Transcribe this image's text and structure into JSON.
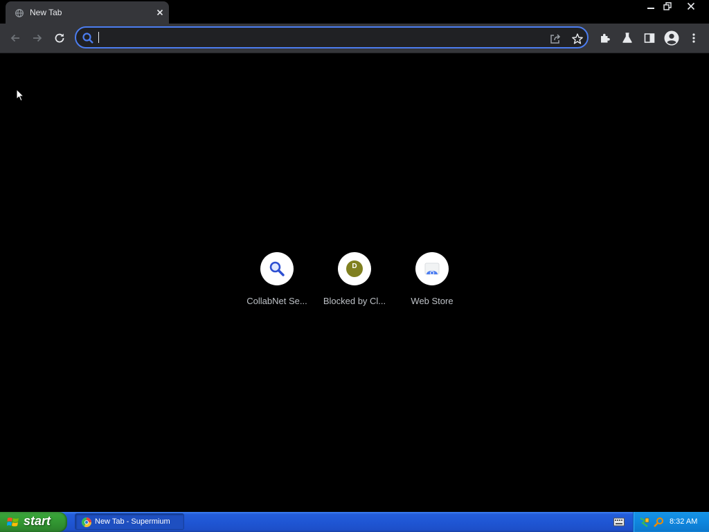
{
  "browser": {
    "tab": {
      "title": "New Tab",
      "favicon": "globe-icon"
    },
    "window_controls": [
      "minimize-icon",
      "restore-icon",
      "close-icon"
    ],
    "omnibox": {
      "value": "",
      "placeholder": ""
    }
  },
  "shortcuts": [
    {
      "label": "CollabNet Se...",
      "icon": "search-icon"
    },
    {
      "label": "Blocked by Cl...",
      "icon": "letter-d-icon",
      "icon_letter": "D",
      "icon_color": "#808020"
    },
    {
      "label": "Web Store",
      "icon": "web-store-icon"
    }
  ],
  "taskbar": {
    "start_label": "start",
    "task_item_label": "New Tab - Supermium",
    "clock": "8:32 AM"
  },
  "colors": {
    "accent": "#4c7df0",
    "page_background": "#000000",
    "toolbar": "#35363a",
    "taskbar_blue": "#245edb",
    "start_green": "#37a337"
  }
}
